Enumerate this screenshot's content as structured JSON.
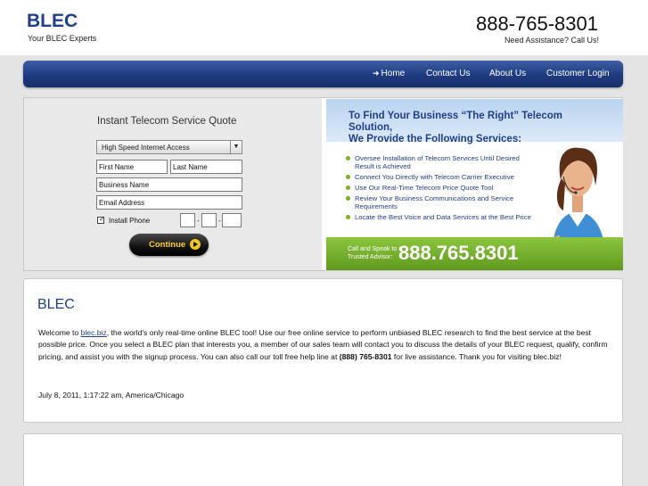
{
  "header": {
    "logo": "BLEC",
    "tagline": "Your BLEC Experts",
    "phone": "888-765-8301",
    "assist": "Need Assistance? Call Us!"
  },
  "nav": {
    "items": [
      {
        "label": "Home"
      },
      {
        "label": "Contact Us"
      },
      {
        "label": "About Us"
      },
      {
        "label": "Customer Login"
      }
    ]
  },
  "quote_form": {
    "title": "Instant Telecom Service Quote",
    "service_selected": "High Speed Internet Access",
    "first_name": "First Name",
    "last_name": "Last Name",
    "business_name": "Business Name",
    "email": "Email Address",
    "install_phone_label": "Install Phone",
    "install_phone_checked": true,
    "continue_label": "Continue"
  },
  "promo": {
    "headline_1": "To Find Your Business “The Right” Telecom Solution,",
    "headline_2": "We Provide the Following Services:",
    "services": [
      "Oversee Installation of Telecom Services Until Desired Result is Achieved",
      "Connect You Directly with Telecom Carrier Executive",
      "Use Our Real-Time Telecom Price Quote Tool",
      "Review Your Business Communications and Service Requirements",
      "Locate the Best Voice and Data Services at the Best Price"
    ],
    "call_text": "Call and Speak to a Trusted Advisor:",
    "phone": "888.765.8301",
    "colors": {
      "headline": "#1f3f8c",
      "bar": "#7ab51d"
    }
  },
  "content": {
    "title": "BLEC",
    "intro_before": "Welcome to ",
    "link": "blec.biz",
    "intro_after": ", the world's only real-time online BLEC tool! Use our free online service to perform unbiased BLEC research to find the best service at the best possible price. Once you select a BLEC plan that interests you, a member of our sales team will contact you to discuss the details of your BLEC request, qualify, confirm pricing, and assist you with the signup process. You can also call our toll free help line at ",
    "help_phone": "(888) 765-8301",
    "intro_end": " for live assistance. Thank you for visiting blec.biz!",
    "date": "July 8, 2011, 1:17:22 am, America/Chicago"
  }
}
